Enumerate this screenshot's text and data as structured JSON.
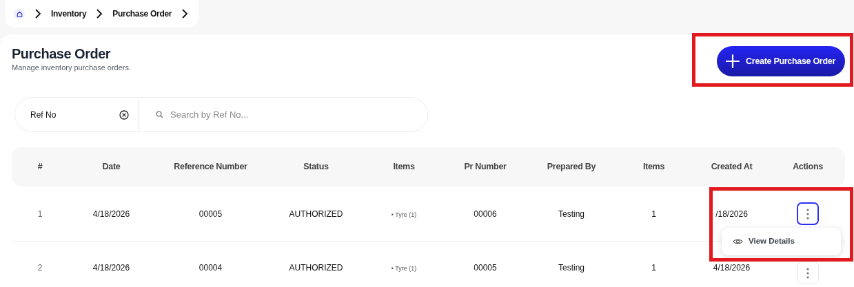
{
  "breadcrumb": [
    {
      "label": "Inventory"
    },
    {
      "label": "Purchase Order"
    }
  ],
  "header": {
    "title": "Purchase Order",
    "subtitle": "Manage inventory purchase orders."
  },
  "create_button": {
    "label": "Create Purchase Order",
    "highlighted": true
  },
  "actions_highlighted": true,
  "filter": {
    "field": "Ref No",
    "placeholder": "Search by Ref No..."
  },
  "table": {
    "columns": [
      "#",
      "Date",
      "Reference Number",
      "Status",
      "Items",
      "Pr Number",
      "Prepared By",
      "Items",
      "Created At",
      "Actions"
    ],
    "rows": [
      {
        "index": "1",
        "date": "4/18/2026",
        "reference": "00005",
        "status": "AUTHORIZED",
        "items": "• Tyre (1)",
        "pr_number": "00006",
        "prepared_by": "Testing",
        "item_count": "1",
        "created_at": "/18/2026",
        "menu_open": true
      },
      {
        "index": "2",
        "date": "4/18/2026",
        "reference": "00004",
        "status": "AUTHORIZED",
        "items": "• Tyre (1)",
        "pr_number": "00005",
        "prepared_by": "Testing",
        "item_count": "1",
        "created_at": "4/18/2026",
        "menu_open": false
      }
    ]
  },
  "action_menu": [
    {
      "label": "View Details"
    }
  ]
}
